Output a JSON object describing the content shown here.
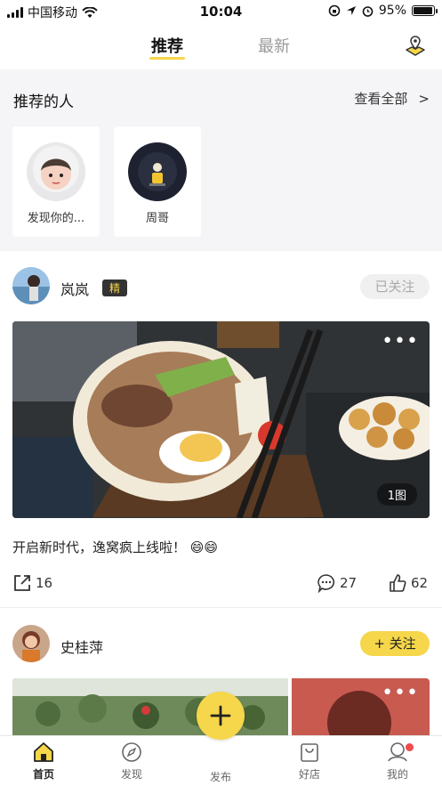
{
  "status_bar": {
    "carrier": "中国移动",
    "time": "10:04",
    "battery": "95%"
  },
  "top_tabs": {
    "recommended": "推荐",
    "latest": "最新"
  },
  "recommend_people": {
    "title": "推荐的人",
    "see_all": "查看全部",
    "people": [
      {
        "name": "发现你的..."
      },
      {
        "name": "周哥"
      }
    ]
  },
  "posts": [
    {
      "user": "岚岚",
      "badge": "精",
      "follow_label": "已关注",
      "more": "•••",
      "image_count": "1图",
      "text": "开启新时代，逸窝疯上线啦！",
      "emoji": "😄😄",
      "share_count": "16",
      "comment_count": "27",
      "like_count": "62"
    },
    {
      "user": "史桂萍",
      "follow_label": "+ 关注",
      "more": "•••"
    }
  ],
  "tabbar": {
    "home": "首页",
    "discover": "发现",
    "publish": "发布",
    "shop": "好店",
    "mine": "我的"
  },
  "colors": {
    "accent": "#f6d64a",
    "background_section": "#f5f5f7",
    "notification_dot": "#ef4b4b"
  }
}
